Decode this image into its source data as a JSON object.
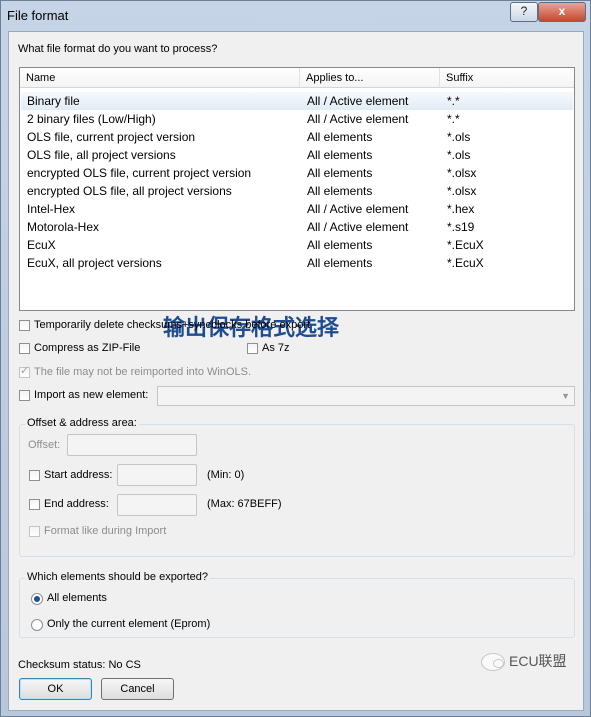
{
  "window": {
    "title": "File format",
    "help_label": "?",
    "close_label": "x"
  },
  "question": "What file format do you want to process?",
  "list": {
    "columns": {
      "name": "Name",
      "applies": "Applies to...",
      "suffix": "Suffix"
    },
    "rows": [
      {
        "name": "Binary file",
        "applies": "All / Active element",
        "suffix": "*.*"
      },
      {
        "name": "2 binary files (Low/High)",
        "applies": "All / Active element",
        "suffix": "*.*"
      },
      {
        "name": "OLS file, current project version",
        "applies": "All elements",
        "suffix": "*.ols"
      },
      {
        "name": "OLS file, all project versions",
        "applies": "All elements",
        "suffix": "*.ols"
      },
      {
        "name": "encrypted OLS file, current project version",
        "applies": "All elements",
        "suffix": "*.olsx"
      },
      {
        "name": "encrypted OLS file, all project versions",
        "applies": "All elements",
        "suffix": "*.olsx"
      },
      {
        "name": "Intel-Hex",
        "applies": "All / Active element",
        "suffix": "*.hex"
      },
      {
        "name": "Motorola-Hex",
        "applies": "All / Active element",
        "suffix": "*.s19"
      },
      {
        "name": "EcuX",
        "applies": "All elements",
        "suffix": "*.EcuX"
      },
      {
        "name": "EcuX, all project versions",
        "applies": "All elements",
        "suffix": "*.EcuX"
      }
    ]
  },
  "overlay_text": "输出保存格式选择",
  "options": {
    "temp_delete": "Temporarily delete checksums+syncblocks before export",
    "compress_zip": "Compress as ZIP-File",
    "as_7z": "As 7z",
    "no_reimport": "The file may not be reimported into WinOLS.",
    "import_new": "Import as new element:"
  },
  "offset_group": {
    "title": "Offset & address area:",
    "offset_label": "Offset:",
    "start_label": "Start address:",
    "start_min": "(Min: 0)",
    "end_label": "End address:",
    "end_max": "(Max: 67BEFF)",
    "format_like": "Format like during Import"
  },
  "export_group": {
    "title": "Which elements should be exported?",
    "all": "All elements",
    "current": "Only the current element (Eprom)"
  },
  "checksum_status": "Checksum status: No CS",
  "buttons": {
    "ok": "OK",
    "cancel": "Cancel"
  },
  "watermark": "ECU联盟"
}
